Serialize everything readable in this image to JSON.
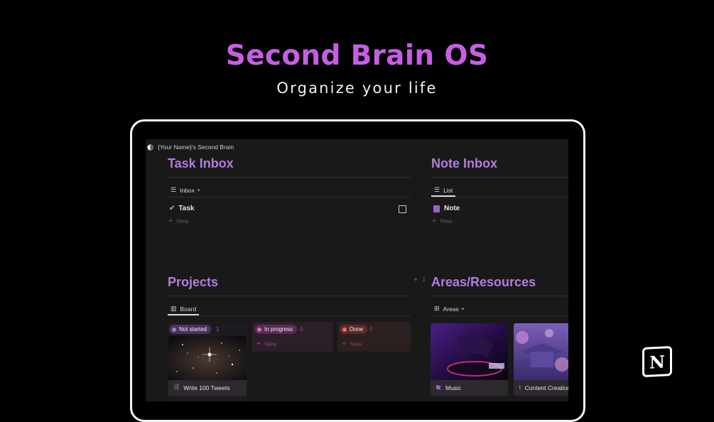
{
  "hero": {
    "title": "Second Brain OS",
    "subtitle": "Organize your life"
  },
  "workspace": {
    "name": "{Your Name}'s Second Brain"
  },
  "task_inbox": {
    "title": "Task Inbox",
    "view": "Inbox",
    "items": [
      {
        "label": "Task"
      }
    ],
    "new_label": "New"
  },
  "note_inbox": {
    "title": "Note Inbox",
    "view": "List",
    "items": [
      {
        "label": "Note"
      }
    ],
    "new_label": "New"
  },
  "projects": {
    "title": "Projects",
    "view": "Board",
    "columns": [
      {
        "status": "Not started",
        "count": "1",
        "color": "#8a5bbd",
        "card": "Write 100 Tweets"
      },
      {
        "status": "In progress",
        "count": "0",
        "color": "#c04fa8",
        "new_label": "New"
      },
      {
        "status": "Done",
        "count": "0",
        "color": "#d8665f",
        "new_label": "New"
      }
    ]
  },
  "areas": {
    "title": "Areas/Resources",
    "view": "Areas",
    "cards": [
      {
        "label": "Music"
      },
      {
        "label": "Content Creation"
      }
    ]
  },
  "icons": [
    "list-icon",
    "chevron-down-icon",
    "check-icon",
    "checkbox-icon",
    "note-icon",
    "plus-icon",
    "board-icon",
    "gallery-icon",
    "doc-icon",
    "flag-icon",
    "drag-handle-icon",
    "notion-logo-icon"
  ],
  "colors": {
    "accent": "#c65ee3",
    "section_title": "#b47be0",
    "background": "#000000",
    "screen_bg": "#191919"
  }
}
